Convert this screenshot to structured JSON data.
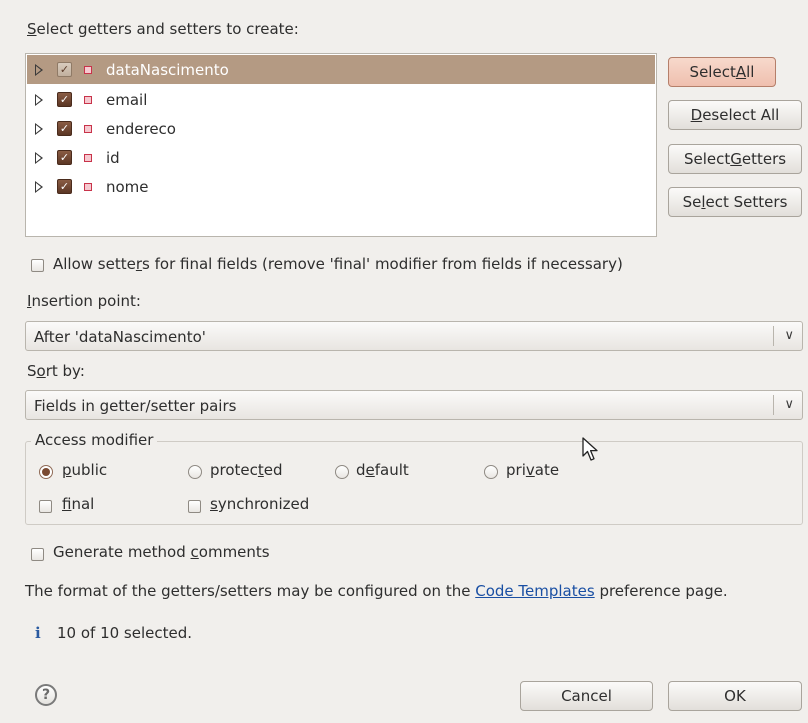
{
  "header_pre": "",
  "header_mnemonic": "S",
  "header_post": "elect getters and setters to create:",
  "fields": [
    {
      "name": "dataNascimento",
      "checked": true,
      "selected": true
    },
    {
      "name": "email",
      "checked": true,
      "selected": false
    },
    {
      "name": "endereco",
      "checked": true,
      "selected": false
    },
    {
      "name": "id",
      "checked": true,
      "selected": false
    },
    {
      "name": "nome",
      "checked": true,
      "selected": false
    }
  ],
  "buttons": {
    "select_all": {
      "pre": "Select ",
      "mn": "A",
      "post": "ll"
    },
    "deselect_all": {
      "pre": "",
      "mn": "D",
      "post": "eselect All"
    },
    "select_getters": {
      "pre": "Select ",
      "mn": "G",
      "post": "etters"
    },
    "select_setters": {
      "pre": "Se",
      "mn": "l",
      "post": "ect Setters"
    }
  },
  "allow_setters": {
    "pre": "Allow sette",
    "mn": "r",
    "post": "s for final fields (remove 'final' modifier from fields if necessary)",
    "checked": false
  },
  "insertion": {
    "label_mn": "I",
    "label_post": "nsertion point:",
    "value": "After 'dataNascimento'"
  },
  "sort": {
    "label_pre": "S",
    "label_mn": "o",
    "label_post": "rt by:",
    "value": "Fields in getter/setter pairs"
  },
  "access": {
    "title": "Access modifier",
    "public": {
      "pre": "",
      "mn": "p",
      "post": "ublic",
      "selected": true
    },
    "protected": {
      "pre": "protec",
      "mn": "t",
      "post": "ed"
    },
    "default": {
      "pre": "d",
      "mn": "e",
      "post": "fault"
    },
    "private": {
      "pre": "pri",
      "mn": "v",
      "post": "ate"
    },
    "final": {
      "pre": "",
      "mn": "f",
      "post": "inal"
    },
    "synchronized": {
      "pre": "",
      "mn": "s",
      "post": "ynchronized"
    }
  },
  "comments": {
    "pre": "Generate method ",
    "mn": "c",
    "post": "omments"
  },
  "info": {
    "pre": "The format of the getters/setters may be configured on the ",
    "link": "Code Templates",
    "post": " preference page."
  },
  "status": {
    "icon": "i",
    "text": "10 of 10 selected."
  },
  "help_glyph": "?",
  "cancel": "Cancel",
  "ok": "OK",
  "combo_arrow": "∨",
  "icons": [
    "expand-triangle-icon",
    "checkbox-icon",
    "field-icon",
    "help-icon",
    "info-icon",
    "mouse-cursor-icon",
    "dropdown-arrow-icon"
  ]
}
